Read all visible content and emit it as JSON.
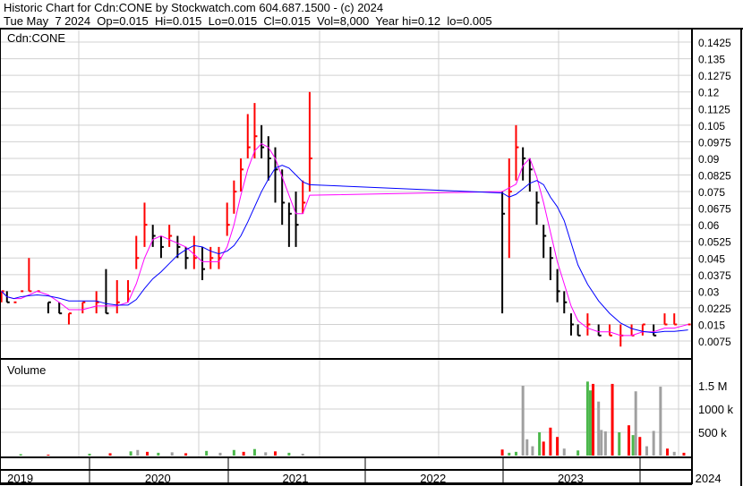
{
  "header": {
    "title": "Historic Chart for Cdn:CONE by Stockwatch.com 604.687.1500 - (c) 2024",
    "quote": "Tue May  7 2024  Op=0.015  Hi=0.015  Lo=0.015  Cl=0.015  Vol=8,000  Year hi=0.12  lo=0.005"
  },
  "chart_data": {
    "type": "line",
    "symbol_label": "Cdn:CONE",
    "volume_label": "Volume",
    "price_ticks": [
      "0.1425",
      "0.135",
      "0.1275",
      "0.12",
      "0.1125",
      "0.105",
      "0.0975",
      "0.09",
      "0.0825",
      "0.075",
      "0.0675",
      "0.06",
      "0.0525",
      "0.045",
      "0.0375",
      "0.03",
      "0.0225",
      "0.015",
      "0.0075"
    ],
    "volume_ticks": [
      {
        "label": "1.5 M",
        "value": 1500
      },
      {
        "label": "1000 k",
        "value": 1000
      },
      {
        "label": "500 k",
        "value": 500
      }
    ],
    "years": [
      "2019",
      "2020",
      "2021",
      "2022",
      "2023",
      "2024"
    ],
    "colors": {
      "up": "#ff0000",
      "down": "#000000",
      "ma_short": "#ff00ff",
      "ma_long": "#0000ff",
      "vol_up": "#4cb84c",
      "vol_down": "#ff0000",
      "vol_flat": "#a0a0a0"
    },
    "price": [
      [
        2019.36,
        0.03,
        0.03,
        0.025
      ],
      [
        2019.4,
        0.025,
        0.03,
        0.025
      ],
      [
        2019.45,
        0.025,
        0.025,
        0.025
      ],
      [
        2019.5,
        0.03,
        0.03,
        0.03
      ],
      [
        2019.56,
        0.03,
        0.045,
        0.03
      ],
      [
        2019.62,
        0.03,
        0.03,
        0.03
      ],
      [
        2019.7,
        0.025,
        0.025,
        0.02
      ],
      [
        2019.78,
        0.02,
        0.025,
        0.02
      ],
      [
        2019.85,
        0.02,
        0.02,
        0.015
      ],
      [
        2019.95,
        0.025,
        0.025,
        0.02
      ],
      [
        2020.05,
        0.025,
        0.03,
        0.02
      ],
      [
        2020.12,
        0.02,
        0.04,
        0.02
      ],
      [
        2020.2,
        0.025,
        0.035,
        0.02
      ],
      [
        2020.28,
        0.03,
        0.035,
        0.025
      ],
      [
        2020.34,
        0.045,
        0.055,
        0.04
      ],
      [
        2020.4,
        0.06,
        0.07,
        0.05
      ],
      [
        2020.46,
        0.055,
        0.06,
        0.05
      ],
      [
        2020.52,
        0.05,
        0.055,
        0.045
      ],
      [
        2020.58,
        0.055,
        0.06,
        0.05
      ],
      [
        2020.64,
        0.05,
        0.055,
        0.045
      ],
      [
        2020.7,
        0.045,
        0.05,
        0.04
      ],
      [
        2020.76,
        0.045,
        0.055,
        0.04
      ],
      [
        2020.82,
        0.04,
        0.05,
        0.035
      ],
      [
        2020.88,
        0.045,
        0.05,
        0.04
      ],
      [
        2020.94,
        0.045,
        0.05,
        0.04
      ],
      [
        2021.0,
        0.06,
        0.07,
        0.055
      ],
      [
        2021.05,
        0.075,
        0.08,
        0.065
      ],
      [
        2021.1,
        0.085,
        0.09,
        0.075
      ],
      [
        2021.15,
        0.095,
        0.11,
        0.09
      ],
      [
        2021.2,
        0.1,
        0.115,
        0.09
      ],
      [
        2021.25,
        0.095,
        0.105,
        0.09
      ],
      [
        2021.3,
        0.09,
        0.1,
        0.08
      ],
      [
        2021.35,
        0.085,
        0.095,
        0.07
      ],
      [
        2021.4,
        0.07,
        0.085,
        0.06
      ],
      [
        2021.45,
        0.065,
        0.07,
        0.05
      ],
      [
        2021.5,
        0.06,
        0.075,
        0.05
      ],
      [
        2021.55,
        0.07,
        0.08,
        0.065
      ],
      [
        2021.6,
        0.09,
        0.12,
        0.075
      ],
      [
        2023.0,
        0.065,
        0.075,
        0.02
      ],
      [
        2023.05,
        0.075,
        0.09,
        0.045
      ],
      [
        2023.1,
        0.095,
        0.105,
        0.08
      ],
      [
        2023.15,
        0.09,
        0.095,
        0.08
      ],
      [
        2023.2,
        0.085,
        0.09,
        0.075
      ],
      [
        2023.25,
        0.07,
        0.075,
        0.06
      ],
      [
        2023.3,
        0.055,
        0.06,
        0.045
      ],
      [
        2023.35,
        0.045,
        0.05,
        0.035
      ],
      [
        2023.4,
        0.03,
        0.04,
        0.025
      ],
      [
        2023.45,
        0.025,
        0.03,
        0.02
      ],
      [
        2023.5,
        0.015,
        0.02,
        0.01
      ],
      [
        2023.55,
        0.01,
        0.015,
        0.01
      ],
      [
        2023.62,
        0.015,
        0.02,
        0.01
      ],
      [
        2023.7,
        0.01,
        0.015,
        0.01
      ],
      [
        2023.78,
        0.01,
        0.015,
        0.01
      ],
      [
        2023.86,
        0.01,
        0.015,
        0.005
      ],
      [
        2023.94,
        0.01,
        0.015,
        0.01
      ],
      [
        2024.02,
        0.015,
        0.015,
        0.01
      ],
      [
        2024.1,
        0.01,
        0.015,
        0.01
      ],
      [
        2024.18,
        0.015,
        0.02,
        0.015
      ],
      [
        2024.25,
        0.015,
        0.02,
        0.015
      ],
      [
        2024.35,
        0.015,
        0.015,
        0.015
      ]
    ],
    "volume": [
      [
        2019.5,
        30,
        "u"
      ],
      [
        2019.7,
        20,
        "d"
      ],
      [
        2020.0,
        40,
        "u"
      ],
      [
        2020.15,
        50,
        "d"
      ],
      [
        2020.3,
        90,
        "u"
      ],
      [
        2020.35,
        120,
        "f"
      ],
      [
        2020.42,
        80,
        "d"
      ],
      [
        2020.5,
        60,
        "u"
      ],
      [
        2020.6,
        70,
        "f"
      ],
      [
        2020.7,
        50,
        "d"
      ],
      [
        2020.85,
        100,
        "u"
      ],
      [
        2020.95,
        60,
        "f"
      ],
      [
        2021.05,
        120,
        "u"
      ],
      [
        2021.12,
        80,
        "d"
      ],
      [
        2021.2,
        140,
        "u"
      ],
      [
        2021.28,
        70,
        "f"
      ],
      [
        2021.35,
        90,
        "d"
      ],
      [
        2021.45,
        60,
        "u"
      ],
      [
        2021.55,
        40,
        "f"
      ],
      [
        2023.0,
        130,
        "d"
      ],
      [
        2023.05,
        60,
        "u"
      ],
      [
        2023.1,
        80,
        "u"
      ],
      [
        2023.15,
        1500,
        "f"
      ],
      [
        2023.18,
        350,
        "f"
      ],
      [
        2023.22,
        200,
        "f"
      ],
      [
        2023.27,
        500,
        "u"
      ],
      [
        2023.3,
        300,
        "d"
      ],
      [
        2023.35,
        600,
        "d"
      ],
      [
        2023.4,
        400,
        "d"
      ],
      [
        2023.45,
        150,
        "f"
      ],
      [
        2023.55,
        110,
        "u"
      ],
      [
        2023.62,
        1590,
        "u"
      ],
      [
        2023.64,
        1400,
        "u"
      ],
      [
        2023.66,
        1540,
        "d"
      ],
      [
        2023.7,
        1160,
        "f"
      ],
      [
        2023.72,
        550,
        "f"
      ],
      [
        2023.75,
        520,
        "f"
      ],
      [
        2023.8,
        1540,
        "d"
      ],
      [
        2023.85,
        500,
        "u"
      ],
      [
        2023.92,
        650,
        "d"
      ],
      [
        2023.95,
        440,
        "u"
      ],
      [
        2023.97,
        1380,
        "f"
      ],
      [
        2024.0,
        400,
        "d"
      ],
      [
        2024.05,
        200,
        "f"
      ],
      [
        2024.1,
        530,
        "f"
      ],
      [
        2024.15,
        1480,
        "f"
      ],
      [
        2024.2,
        150,
        "d"
      ],
      [
        2024.25,
        80,
        "f"
      ],
      [
        2024.32,
        60,
        "d"
      ]
    ]
  }
}
